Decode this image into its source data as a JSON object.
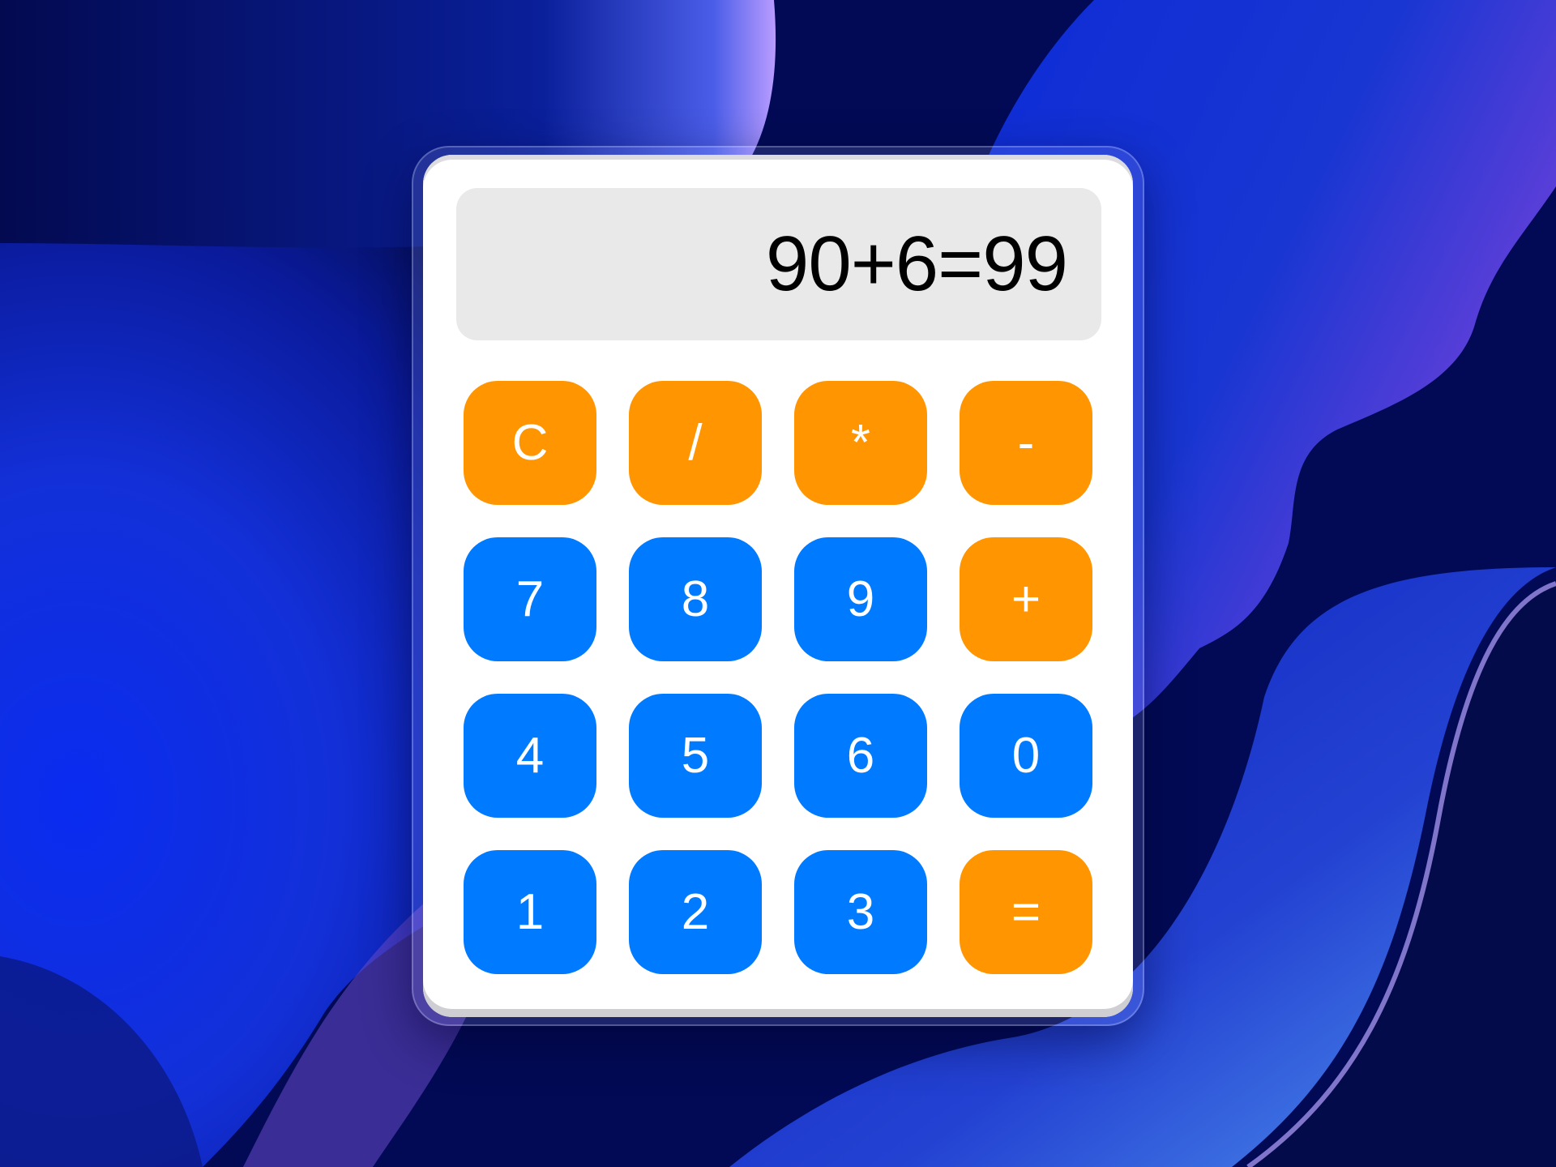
{
  "colors": {
    "operator_key": "#ff9500",
    "number_key": "#007aff",
    "display_bg": "#e9e9e9",
    "body_bg": "#ffffff",
    "wallpaper_dark": "#020a5c",
    "wallpaper_bright": "#0a2cf0"
  },
  "display": {
    "value": "90+6=99"
  },
  "keys": [
    {
      "label": "C",
      "kind": "op"
    },
    {
      "label": "/",
      "kind": "op"
    },
    {
      "label": "*",
      "kind": "op"
    },
    {
      "label": "-",
      "kind": "op"
    },
    {
      "label": "7",
      "kind": "num"
    },
    {
      "label": "8",
      "kind": "num"
    },
    {
      "label": "9",
      "kind": "num"
    },
    {
      "label": "+",
      "kind": "op"
    },
    {
      "label": "4",
      "kind": "num"
    },
    {
      "label": "5",
      "kind": "num"
    },
    {
      "label": "6",
      "kind": "num"
    },
    {
      "label": "0",
      "kind": "num"
    },
    {
      "label": "1",
      "kind": "num"
    },
    {
      "label": "2",
      "kind": "num"
    },
    {
      "label": "3",
      "kind": "num"
    },
    {
      "label": "=",
      "kind": "op"
    }
  ]
}
